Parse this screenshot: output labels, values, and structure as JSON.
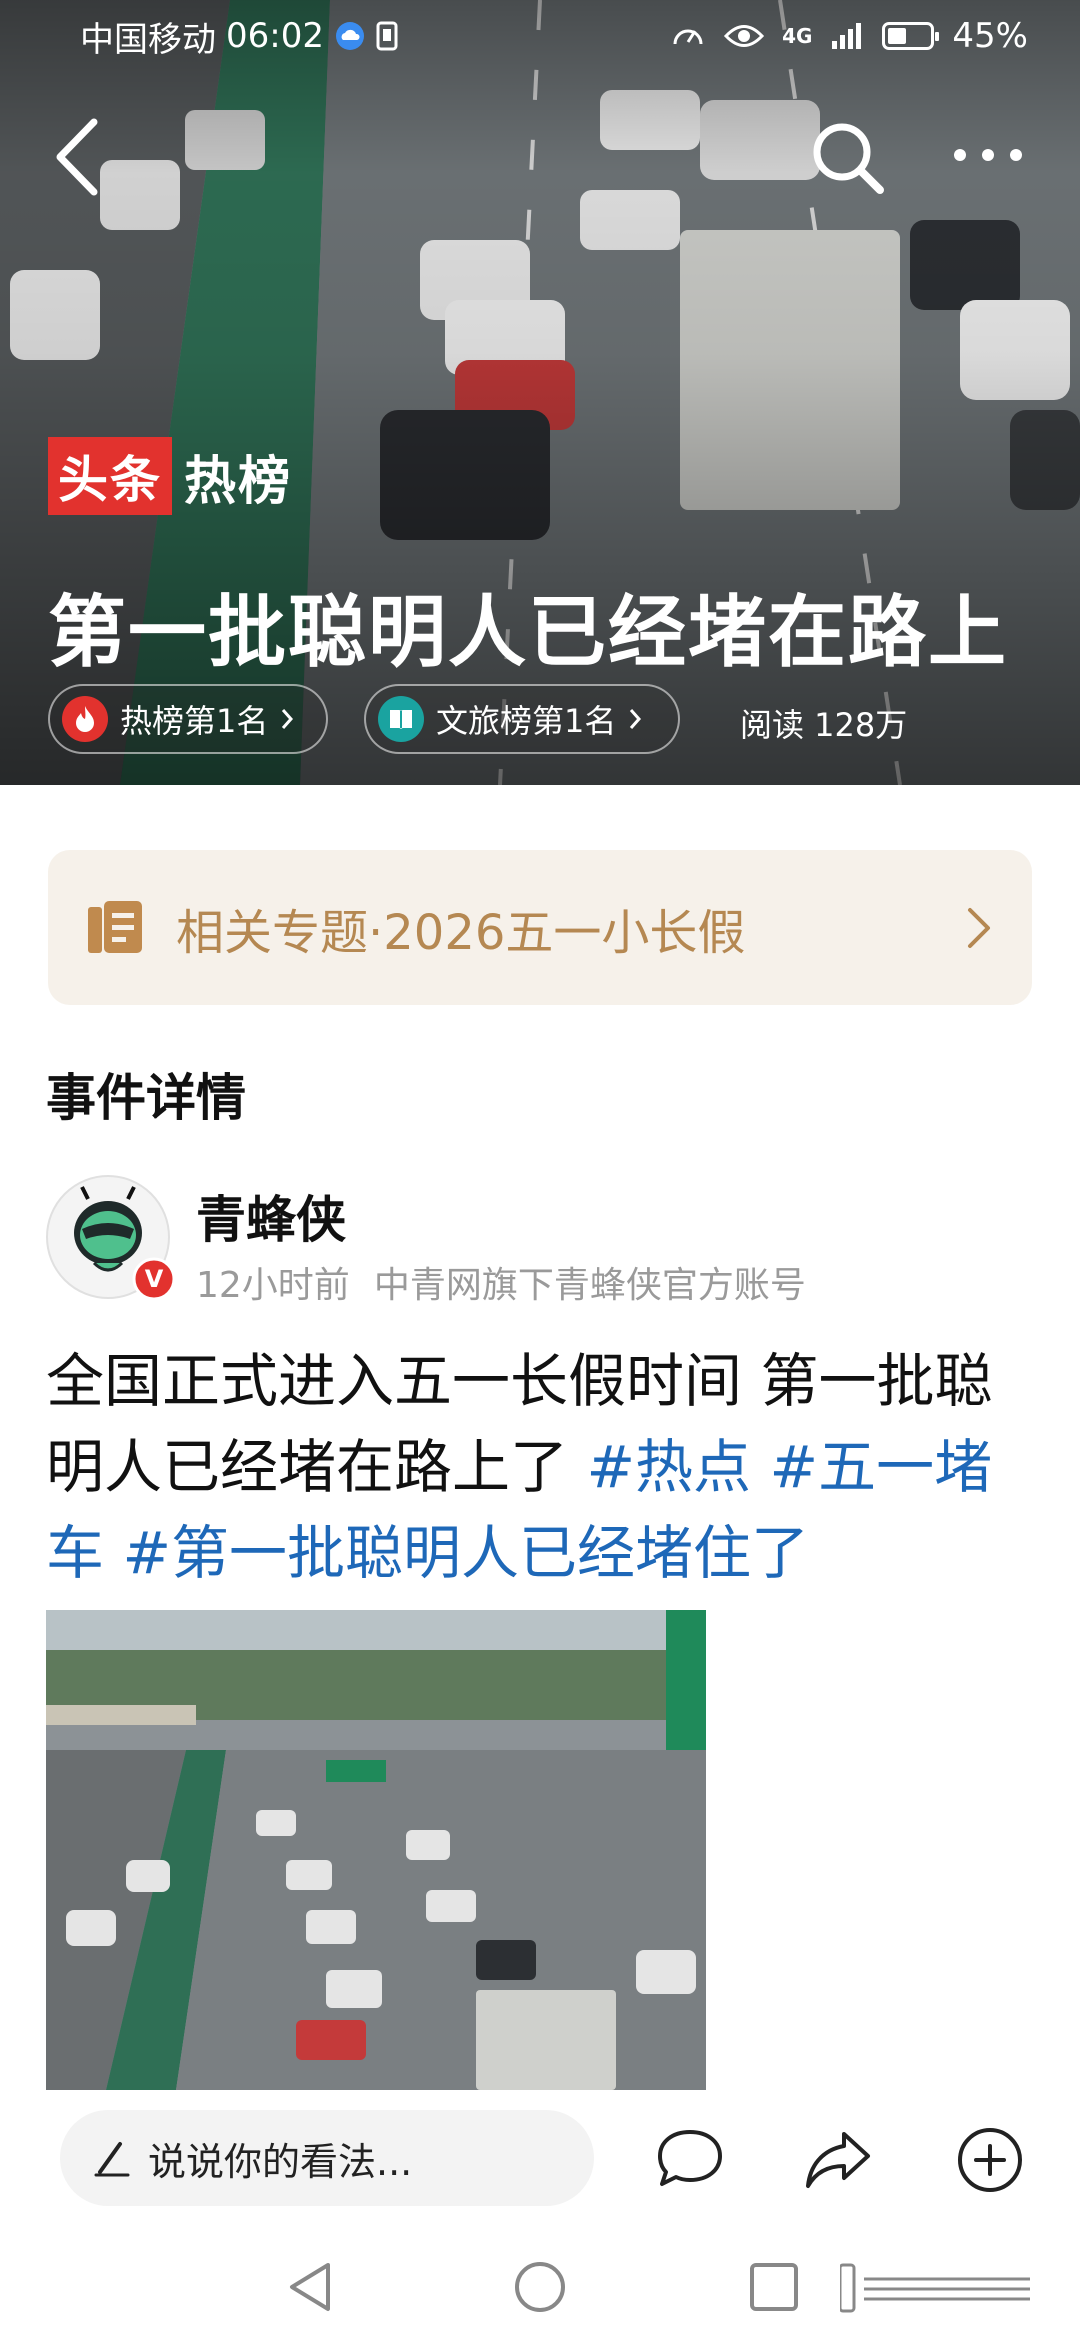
{
  "status_bar": {
    "carrier": "中国移动",
    "time": "06:02",
    "network": "4G",
    "battery_percent": "45%",
    "battery_level": 0.45
  },
  "hero": {
    "brand_red": "头条",
    "brand_white": "热榜",
    "title": "第一批聪明人已经堵在路上",
    "badges": [
      {
        "label": "热榜第1名",
        "icon": "flame-icon",
        "color": "#e2322e"
      },
      {
        "label": "文旅榜第1名",
        "icon": "book-icon",
        "color": "#1aa3a0"
      }
    ],
    "read_count": "阅读 128万",
    "icons": {
      "back": "back-arrow-icon",
      "search": "search-icon",
      "more": "more-icon"
    }
  },
  "topic": {
    "label": "相关专题·2026五一小长假",
    "icon": "document-icon",
    "color": "#b58852"
  },
  "section_title": "事件详情",
  "author": {
    "name": "青蜂侠",
    "time_ago": "12小时前",
    "description": "中青网旗下青蜂侠官方账号",
    "verified_badge": "V"
  },
  "post": {
    "text": "全国正式进入五一长假时间 第一批聪明人已经堵在路上了 ",
    "tags": [
      "#热点",
      "#五一堵车",
      "#第一批聪明人已经堵住了"
    ],
    "tag_color": "#1e68b8"
  },
  "bottom_bar": {
    "comment_placeholder": "说说你的看法...",
    "icons": [
      "pen-icon",
      "comment-icon",
      "share-icon",
      "add-icon"
    ]
  },
  "nav_bar": {
    "icons": [
      "nav-back-icon",
      "nav-home-icon",
      "nav-recent-icon",
      "nav-menu-icon"
    ]
  }
}
